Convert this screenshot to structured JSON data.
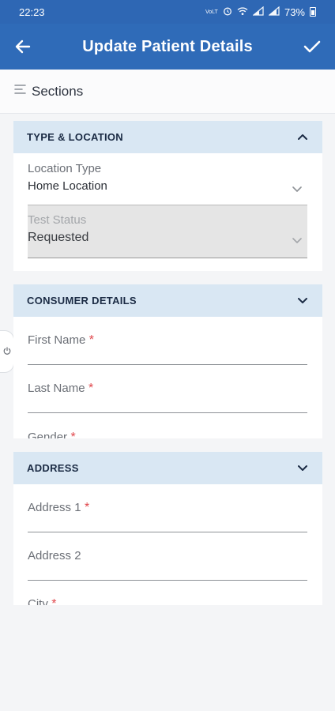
{
  "status_bar": {
    "time": "22:23",
    "battery": "73%",
    "icons": [
      "volte-icon",
      "alarm-icon",
      "wifi-icon",
      "signal-icon",
      "signal-icon",
      "battery-icon"
    ]
  },
  "app_bar": {
    "title": "Update Patient Details",
    "back_icon": "arrow-left-icon",
    "confirm_icon": "check-icon"
  },
  "sections_bar": {
    "label": "Sections",
    "icon": "menu-lines-icon"
  },
  "sections": [
    {
      "title": "TYPE & LOCATION",
      "expanded": true,
      "fields": [
        {
          "label": "Location Type",
          "value": "Home Location",
          "type": "dropdown"
        },
        {
          "label": "Test Status",
          "value": "Requested",
          "type": "dropdown",
          "disabled": true
        }
      ]
    },
    {
      "title": "CONSUMER DETAILS",
      "expanded": false,
      "fields": [
        {
          "label": "First Name",
          "required_mark": "*"
        },
        {
          "label": "Last Name",
          "required_mark": "*"
        },
        {
          "label": "Gender",
          "required_mark": "*"
        }
      ]
    },
    {
      "title": "ADDRESS",
      "expanded": false,
      "fields": [
        {
          "label": "Address 1",
          "required_mark": "*"
        },
        {
          "label": "Address 2",
          "required_mark": ""
        },
        {
          "label": "City",
          "required_mark": "*"
        }
      ]
    }
  ],
  "colors": {
    "primary": "#2f6bb8",
    "section_header_bg": "#d9e7f3",
    "required": "#e0474c"
  }
}
